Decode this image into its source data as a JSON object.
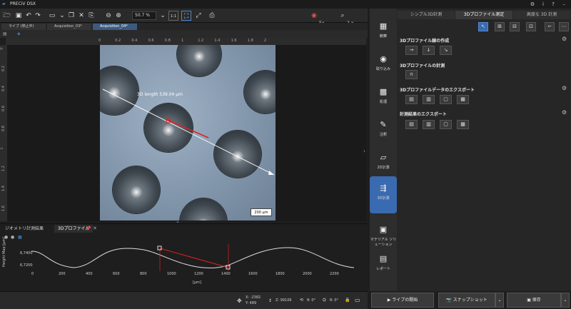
{
  "app": {
    "title": "PRECiV DSX"
  },
  "toolbar": {
    "zoom": "50.7 %",
    "one_to_one": "1:1",
    "laser_label": "5x",
    "zoom2_label": "2 x"
  },
  "doc_tabs": [
    "ライブ (停止中)",
    "Acquisition_03*",
    "Acquisition_04*"
  ],
  "ruler_h": [
    "0",
    "0.2",
    "0.4",
    "0.6",
    "0.8",
    "1",
    "1.2",
    "1.4",
    "1.6",
    "1.8",
    "2"
  ],
  "ruler_v": [
    "0",
    "0.2",
    "0.4",
    "0.6",
    "0.8",
    "1",
    "1.2",
    "1.4",
    "1.6"
  ],
  "image": {
    "measurement_label": "3D length 539.04 µm",
    "scale_label": "200 µm"
  },
  "bottom_tabs": {
    "geometry": "ジオメトリ計測結果",
    "profile": "3Dプロファイル"
  },
  "graph": {
    "ylabel": "Height Map [µm]",
    "xlabel": "[µm]",
    "yticks": [
      "6,7400",
      "6,7200"
    ],
    "xticks": [
      "0",
      "200",
      "400",
      "600",
      "800",
      "1000",
      "1200",
      "1400",
      "1600",
      "1800",
      "2000",
      "2200"
    ]
  },
  "status": {
    "x": "X: -2382",
    "y": "Y: 489",
    "z": "Z: 99106",
    "angle1": "θ: 0°",
    "angle2": "θ: 0°"
  },
  "sidebar": [
    {
      "label": "観察",
      "icon": "observe-icon"
    },
    {
      "label": "取り込み",
      "icon": "camera-icon"
    },
    {
      "label": "処理",
      "icon": "process-icon"
    },
    {
      "label": "注釈",
      "icon": "annotation-icon"
    },
    {
      "label": "2D計測",
      "icon": "measure2d-icon"
    },
    {
      "label": "3D計測",
      "icon": "measure3d-icon"
    },
    {
      "label": "マテリアル ソリューション",
      "icon": "material-icon"
    },
    {
      "label": "レポート",
      "icon": "report-icon"
    }
  ],
  "right_tabs": [
    "シンプル3D計測",
    "3Dプロファイル測定",
    "高度な 3D 計測"
  ],
  "sections": {
    "create": "3Dプロファイル線の作成",
    "measure": "3Dプロファイルの計測",
    "export_data": "3Dプロファイルデータのエクスポート",
    "export_results": "計測結果のエクスポート"
  },
  "bottom_buttons": {
    "live": "ライブの開始",
    "snapshot": "スナップショット",
    "save": "保存"
  }
}
